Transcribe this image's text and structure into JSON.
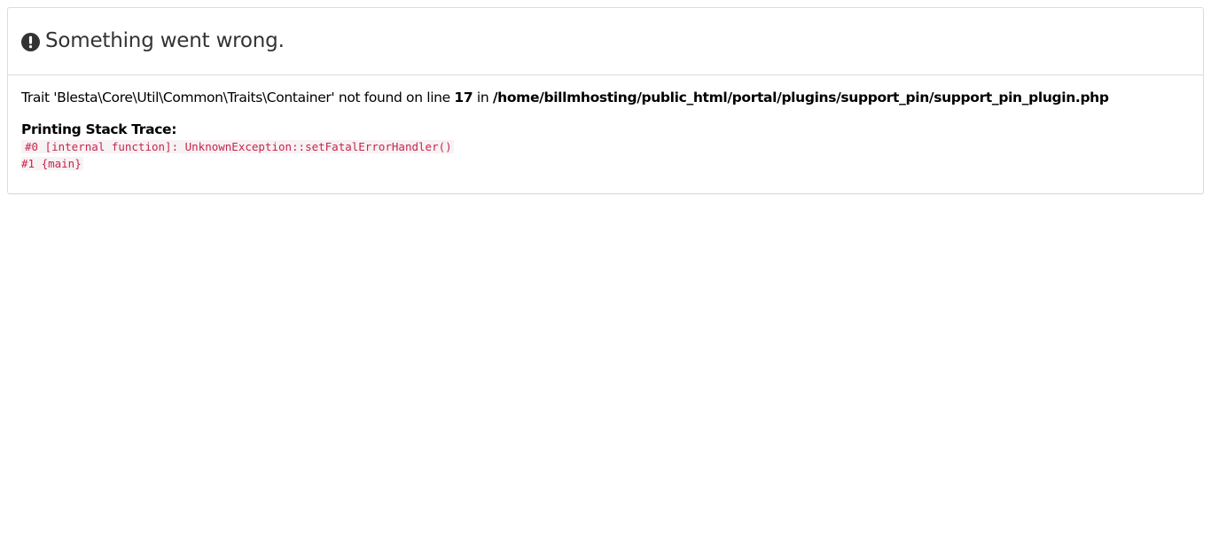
{
  "header": {
    "title": "Something went wrong.",
    "icon": "exclamation-circle-icon"
  },
  "error": {
    "prefix": "Trait 'Blesta\\Core\\Util\\Common\\Traits\\Container' not found on line ",
    "line": "17",
    "middle": " in ",
    "file": "/home/billmhosting/public_html/portal/plugins/support_pin/support_pin_plugin.php"
  },
  "stack_trace": {
    "title": "Printing Stack Trace:",
    "lines": [
      "#0 [internal function]: UnknownException::setFatalErrorHandler()",
      "#1 {main}"
    ]
  },
  "colors": {
    "trace_text": "#c7254e",
    "trace_bg": "#f7f2f4",
    "border": "#dcdcdc",
    "title_text": "#333333"
  }
}
